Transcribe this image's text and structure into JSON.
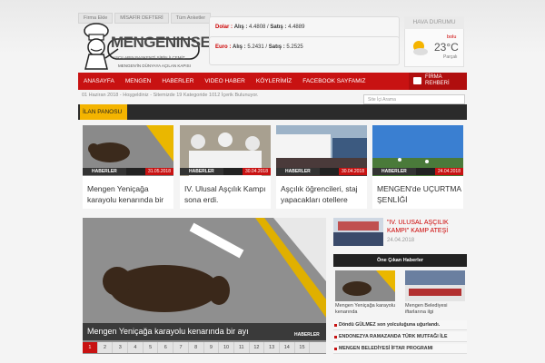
{
  "top_links": [
    "Firma Ekle",
    "MİSAFİR DEFTERİ",
    "Tüm Anketler"
  ],
  "logo": {
    "title": "MENGENINSESI",
    "sub1": "AŞÇILARIN BAŞKENTİ ŞİRİN İLÇEMİZ",
    "sub2": "MENGEN'İN DÜNYAYA AÇILAN KAPISI"
  },
  "currency": {
    "dolar_label": "Dolar :",
    "dolar_alis_label": "Alış :",
    "dolar_alis": "4.4808",
    "dolar_satis_label": "Satış :",
    "dolar_satis": "4.4889",
    "euro_label": "Euro :",
    "euro_alis_label": "Alış :",
    "euro_alis": "5.2431",
    "euro_satis_label": "Satış :",
    "euro_satis": "5.2525"
  },
  "weather": {
    "title": "HAVA DURUMU",
    "city": "bolu",
    "temp": "23°C",
    "condition": "Parçalı"
  },
  "nav": {
    "items": [
      "ANASAYFA",
      "MENGEN",
      "HABERLER",
      "VIDEO HABER",
      "KÖYLERİMİZ",
      "FACEBOOK SAYFAMIZ"
    ],
    "firma_line1": "FİRMA",
    "firma_line2": "REHBERİ"
  },
  "datebar": "01 Haziran 2018 - Hoşgeldiniz - Sitemizde 19 Kategoride 1012 İçerik Bulunuyor.",
  "search_placeholder": "Site İçi Arama",
  "ilan_label": "İLAN PANOSU",
  "cards": [
    {
      "cat": "HABERLER",
      "date": "31.05.2018",
      "title": "Mengen Yeniçağa karayolu kenarında bir"
    },
    {
      "cat": "HABERLER",
      "date": "30.04.2018",
      "title": "IV. Ulusal Aşçılık Kampı sona erdi."
    },
    {
      "cat": "HABERLER",
      "date": "30.04.2018",
      "title": "Aşçılık öğrencileri, staj yapacakları otellere"
    },
    {
      "cat": "HABERLER",
      "date": "24.04.2018",
      "title": "MENGEN'de UÇURTMA ŞENLİĞİ"
    }
  ],
  "slider": {
    "caption": "Mengen Yeniçağa karayolu kenarında bir ayı",
    "cat": "HABERLER",
    "pages": [
      "1",
      "2",
      "3",
      "4",
      "5",
      "6",
      "7",
      "8",
      "9",
      "10",
      "11",
      "12",
      "13",
      "14",
      "15"
    ]
  },
  "right_news": {
    "title": "\"IV. ULUSAL AŞÇILIK KAMPI\" KAMP ATEŞİ",
    "date": "24.04.2018"
  },
  "one_cikan": {
    "head": "Öne Çıkan Haberler",
    "items": [
      {
        "title": "Mengen Yeniçağa karayolu kenarında"
      },
      {
        "title": "Mengen Belediyesi iftarlarına ilgi"
      }
    ],
    "list": [
      "Döndü GÜLMEZ son yolculuğuna uğurlandı.",
      "ENDONEZYA RAMAZANDA TÜRK MUTFAĞI İLE",
      "MENGEN BELEDİYESİ İFTAR PROGRAMI"
    ]
  }
}
